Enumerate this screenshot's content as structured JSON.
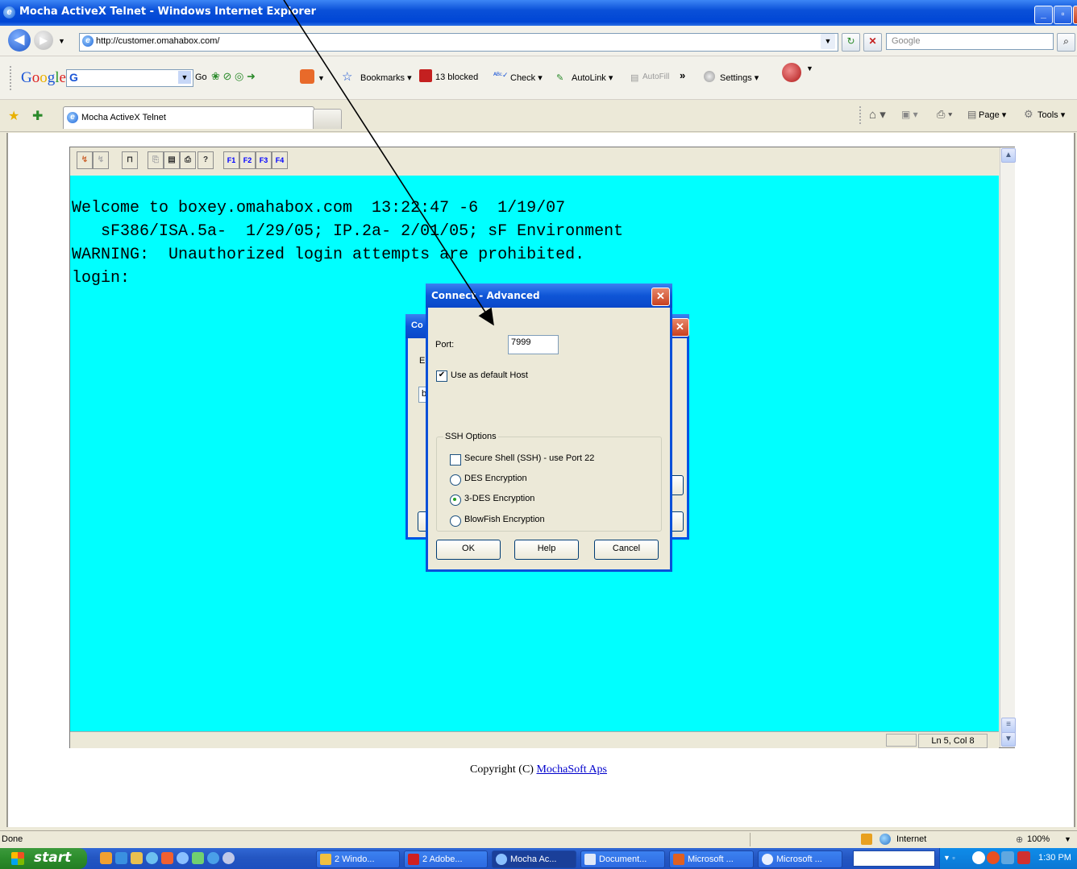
{
  "window": {
    "title": "Mocha ActiveX Telnet - Windows Internet Explorer"
  },
  "address_bar": {
    "url": "http://customer.omahabox.com/",
    "search_placeholder": "Google"
  },
  "google_toolbar": {
    "logo": "Google",
    "combo_value": "G",
    "go_label": "Go",
    "bookmarks_label": "Bookmarks",
    "blocked_label": "13 blocked",
    "check_label": "Check",
    "autolink_label": "AutoLink",
    "autofill_label": "AutoFill",
    "more_label": "»",
    "settings_label": "Settings"
  },
  "tabs": {
    "active_label": "Mocha ActiveX Telnet",
    "page_label": "Page",
    "tools_label": "Tools"
  },
  "applet": {
    "fkeys": [
      "F1",
      "F2",
      "F3",
      "F4"
    ],
    "terminal_lines": [
      "Welcome to boxey.omahabox.com  13:22:47 -6  1/19/07",
      "   sF386/ISA.5a-  1/29/05; IP.2a- 2/01/05; sF Environment",
      "WARNING:  Unauthorized login attempts are prohibited.",
      "login:"
    ],
    "cursor_position": "Ln 5, Col 8"
  },
  "page": {
    "copyright_prefix": "Copyright (C) ",
    "copyright_link": "MochaSoft Aps"
  },
  "dialog_back": {
    "title_fragment": "Co",
    "label_fragment": "E",
    "input_fragment": "b"
  },
  "dialog": {
    "title": "Connect - Advanced",
    "port_label": "Port:",
    "port_value": "7999",
    "default_host_label": "Use as default Host",
    "default_host_checked": true,
    "ssh_group_title": "SSH Options",
    "ssh_label": "Secure Shell (SSH) - use Port 22",
    "ssh_checked": false,
    "encryption_options": [
      "DES Encryption",
      "3-DES Encryption",
      "BlowFish Encryption"
    ],
    "selected_encryption": "3-DES Encryption",
    "ok_label": "OK",
    "help_label": "Help",
    "cancel_label": "Cancel"
  },
  "ie_status": {
    "text": "Done",
    "zone": "Internet",
    "zoom": "100%"
  },
  "taskbar": {
    "start_label": "start",
    "tasks": [
      "2 Windo...",
      "2 Adobe...",
      "Mocha Ac...",
      "Document...",
      "Microsoft ...",
      "Microsoft ..."
    ],
    "active_task": "Mocha Ac...",
    "clock": "1:30 PM"
  },
  "colors": {
    "terminal_bg": "#00ffff",
    "xp_blue": "#0a50d8",
    "start_green": "#2c8c2c",
    "link": "#0000cc"
  }
}
